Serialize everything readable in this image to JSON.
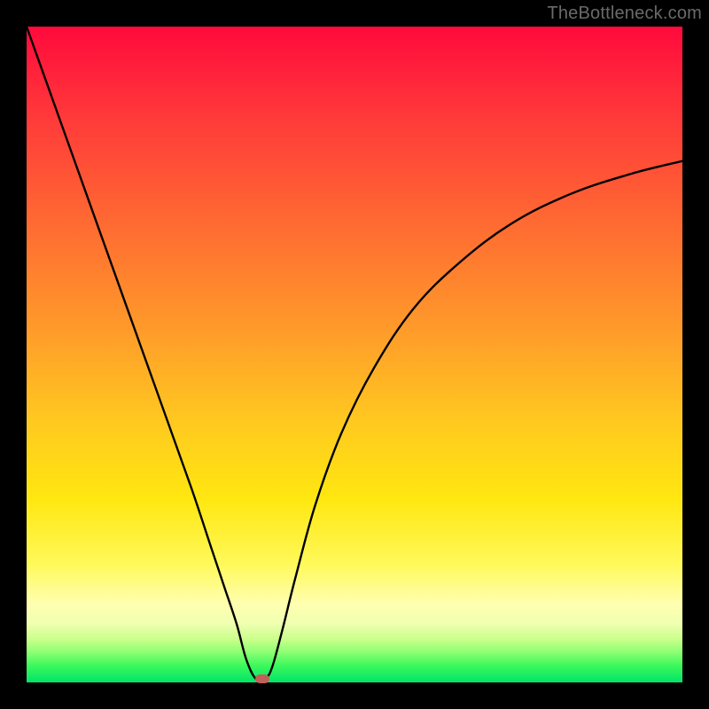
{
  "watermark": "TheBottleneck.com",
  "chart_data": {
    "type": "line",
    "title": "",
    "xlabel": "",
    "ylabel": "",
    "xlim": [
      0,
      100
    ],
    "ylim": [
      0,
      100
    ],
    "grid": false,
    "legend": false,
    "background": "vertical-gradient red→green (bottleneck severity)",
    "series": [
      {
        "name": "bottleneck-curve",
        "x": [
          0,
          5,
          10,
          15,
          20,
          25,
          28,
          30,
          32,
          33.5,
          35,
          36.5,
          37.5,
          39,
          41,
          44,
          48,
          53,
          59,
          66,
          74,
          83,
          92,
          100
        ],
        "values": [
          100,
          86,
          72,
          58,
          44,
          30,
          21,
          15,
          9,
          3.5,
          0.5,
          0.7,
          2.5,
          8,
          16,
          27,
          38,
          48,
          57,
          64,
          70,
          74.5,
          77.5,
          79.5
        ]
      }
    ],
    "marker": {
      "x": 36,
      "y": 0.5,
      "color": "#c06058",
      "shape": "rounded-rect"
    }
  },
  "colors": {
    "frame": "#000000",
    "gradient_top": "#ff0a3c",
    "gradient_bottom": "#00e468",
    "curve": "#000000",
    "marker": "#c06058",
    "watermark": "#6a6a6a"
  }
}
